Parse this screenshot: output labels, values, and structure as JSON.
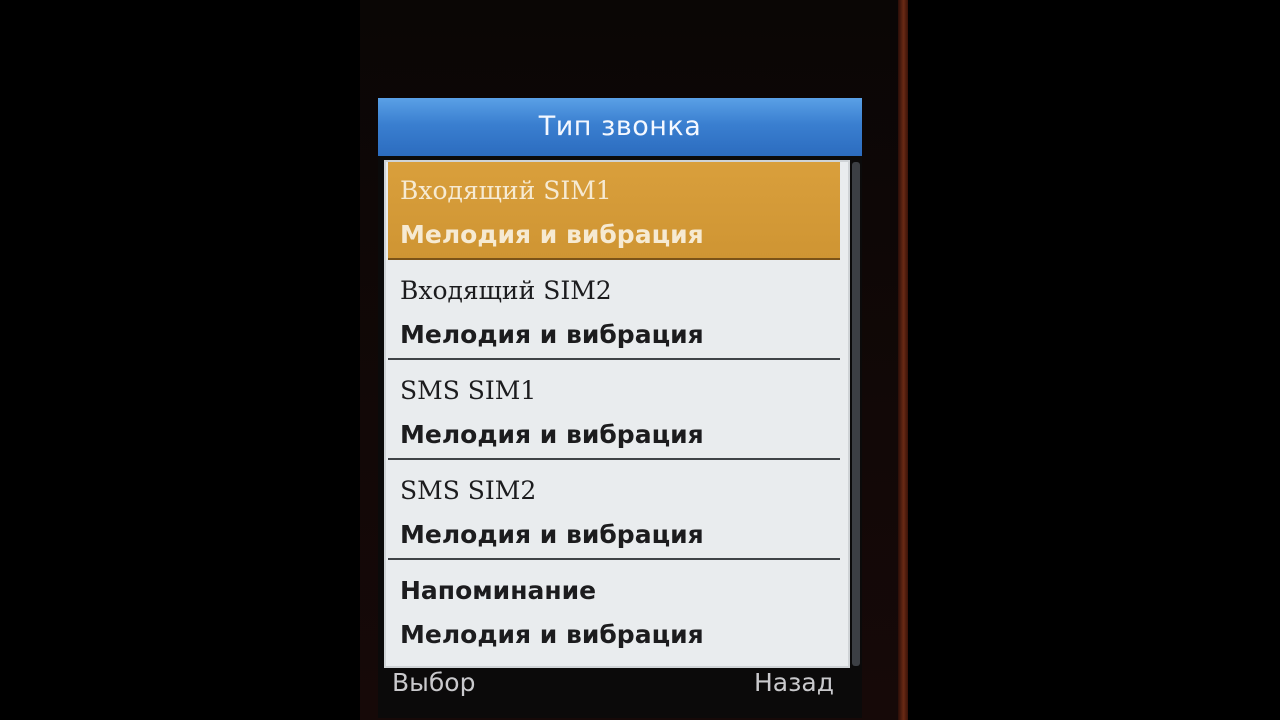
{
  "screen": {
    "title": "Тип звонка"
  },
  "list": {
    "items": [
      {
        "name": "Входящий SIM1",
        "value": "Мелодия и вибрация",
        "selected": true
      },
      {
        "name": "Входящий SIM2",
        "value": "Мелодия и вибрация",
        "selected": false
      },
      {
        "name": "SMS SIM1",
        "value": "Мелодия и вибрация",
        "selected": false
      },
      {
        "name": "SMS SIM2",
        "value": "Мелодия и вибрация",
        "selected": false
      },
      {
        "name": "Напоминание",
        "value": "Мелодия и вибрация",
        "selected": false
      }
    ]
  },
  "softkeys": {
    "left": "Выбор",
    "right": "Назад"
  },
  "colors": {
    "title_bar": "#3a7fd0",
    "selected_item": "#d99f3c",
    "list_bg": "#e9ecee"
  }
}
